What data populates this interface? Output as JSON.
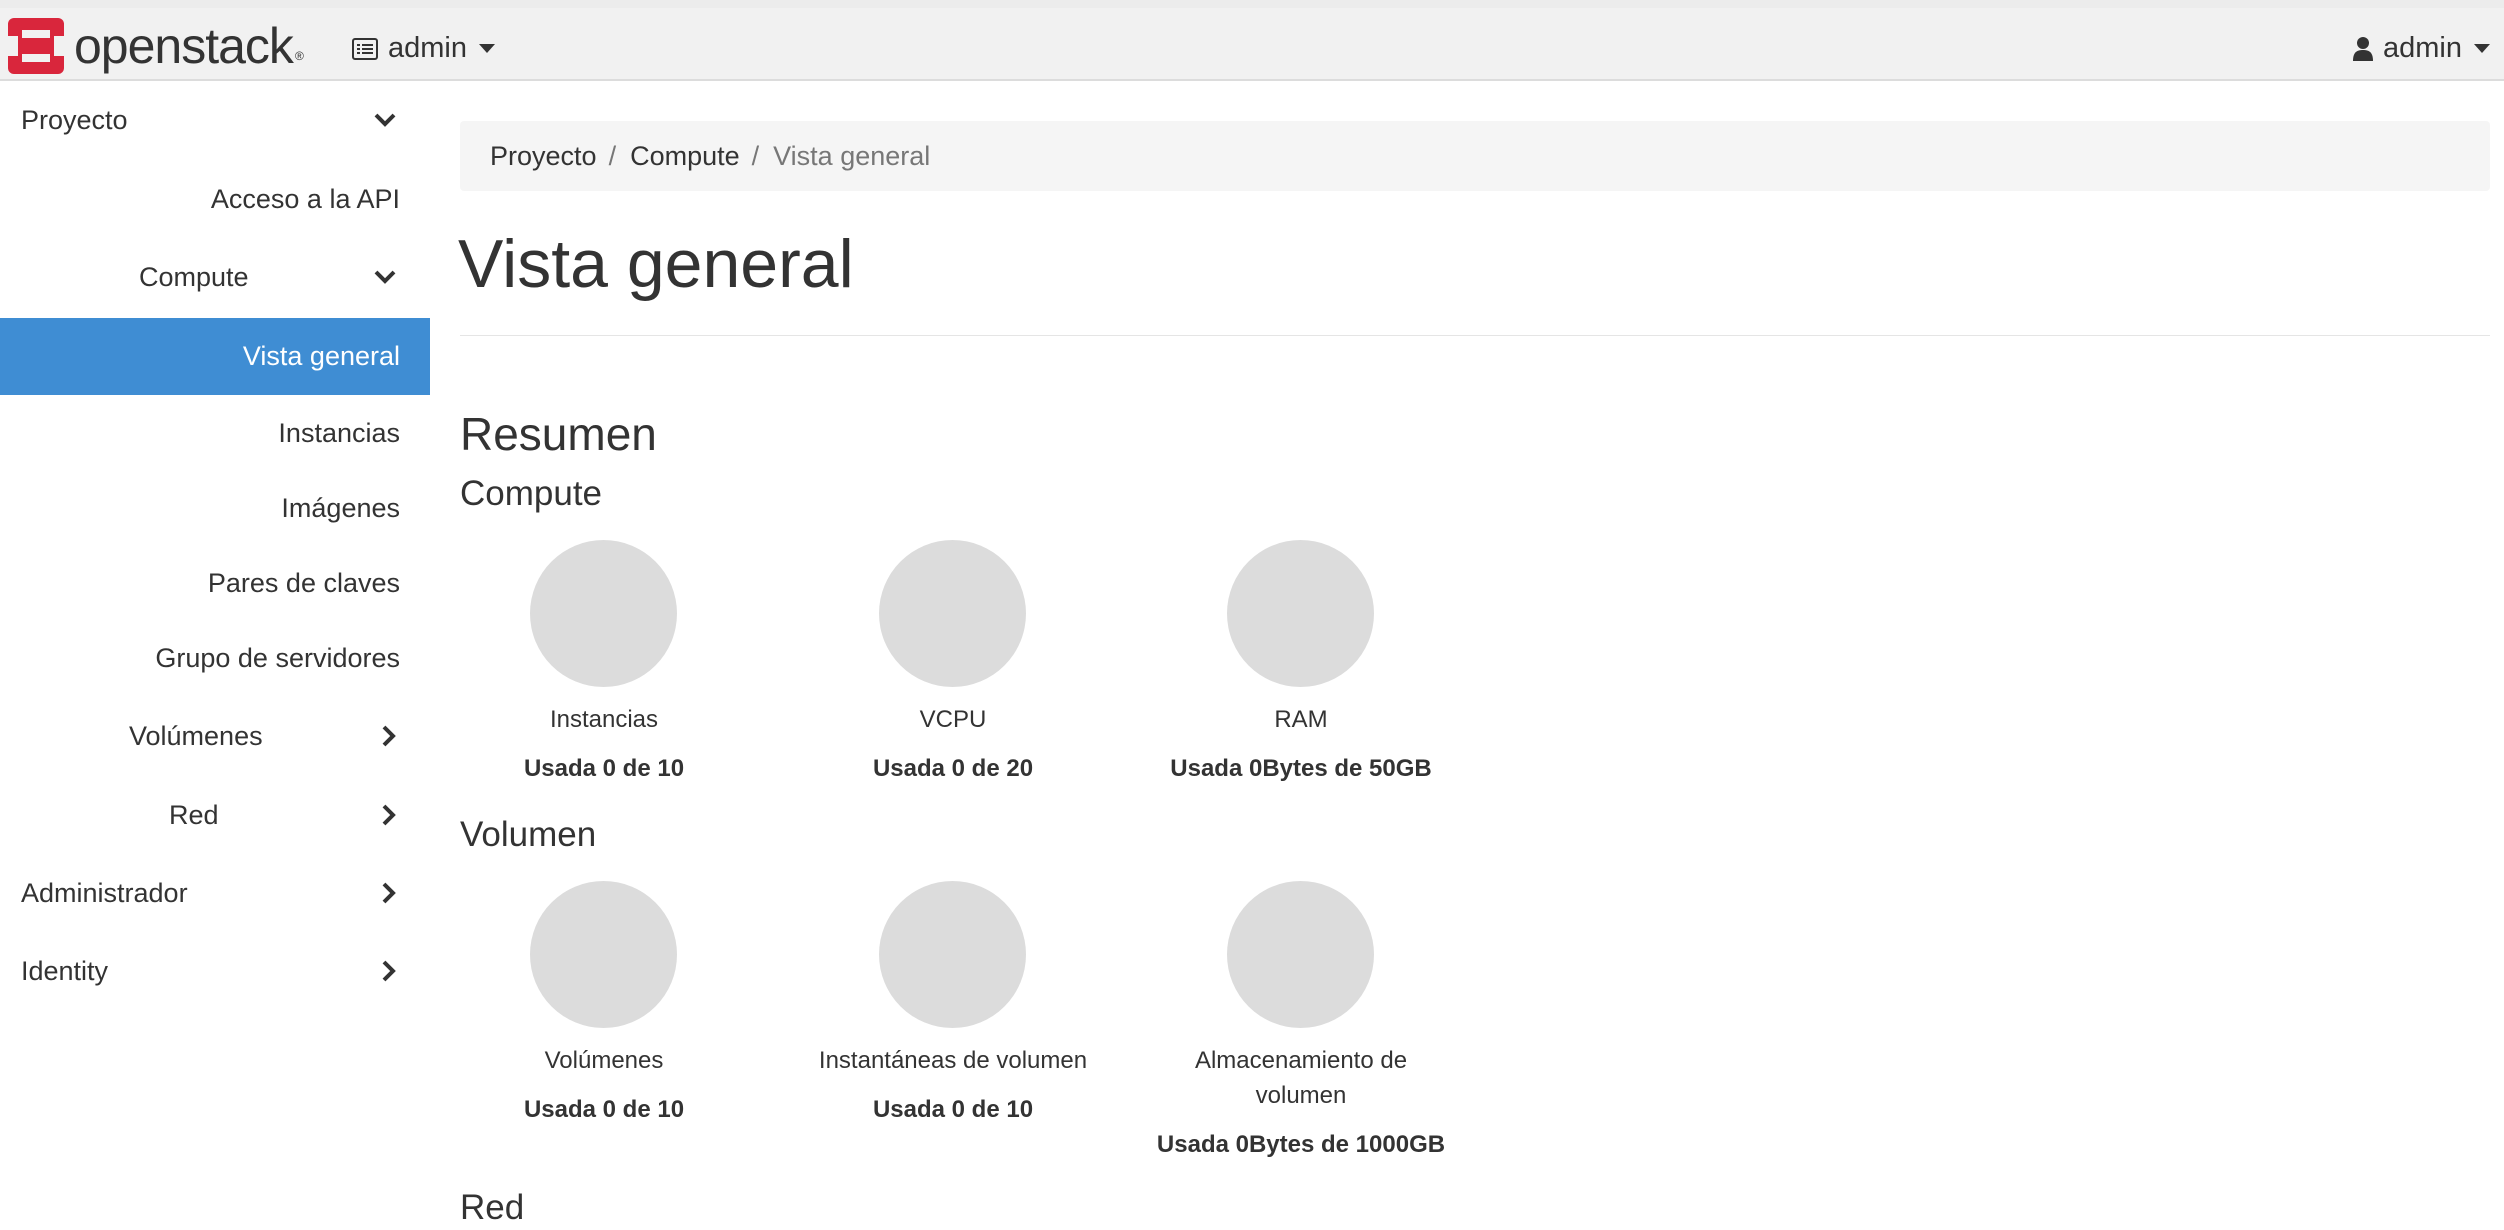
{
  "header": {
    "brand": "openstack",
    "project_menu": "admin",
    "user_menu": "admin"
  },
  "sidebar": {
    "project": "Proyecto",
    "api_access": "Acceso a la API",
    "compute": "Compute",
    "overview": "Vista general",
    "instances": "Instancias",
    "images": "Imágenes",
    "keypairs": "Pares de claves",
    "server_groups": "Grupo de servidores",
    "volumes": "Volúmenes",
    "network": "Red",
    "admin": "Administrador",
    "identity": "Identity"
  },
  "breadcrumb": {
    "item1": "Proyecto",
    "item2": "Compute",
    "current": "Vista general",
    "sep": "/"
  },
  "page": {
    "title": "Vista general",
    "summary_heading": "Resumen",
    "compute_heading": "Compute",
    "volume_heading": "Volumen",
    "network_heading": "Red"
  },
  "compute_charts": [
    {
      "label": "Instancias",
      "usage": "Usada 0 de 10"
    },
    {
      "label": "VCPU",
      "usage": "Usada 0 de 20"
    },
    {
      "label": "RAM",
      "usage": "Usada 0Bytes de 50GB"
    }
  ],
  "volume_charts": [
    {
      "label": "Volúmenes",
      "usage": "Usada 0 de 10"
    },
    {
      "label": "Instantáneas de volumen",
      "usage": "Usada 0 de 10"
    },
    {
      "label": "Almacenamiento de volumen",
      "usage": "Usada 0Bytes de 1000GB"
    }
  ],
  "colors": {
    "accent": "#3f8dd3",
    "logo_red": "#d9263c",
    "pie_gray": "#dcdcdc"
  }
}
